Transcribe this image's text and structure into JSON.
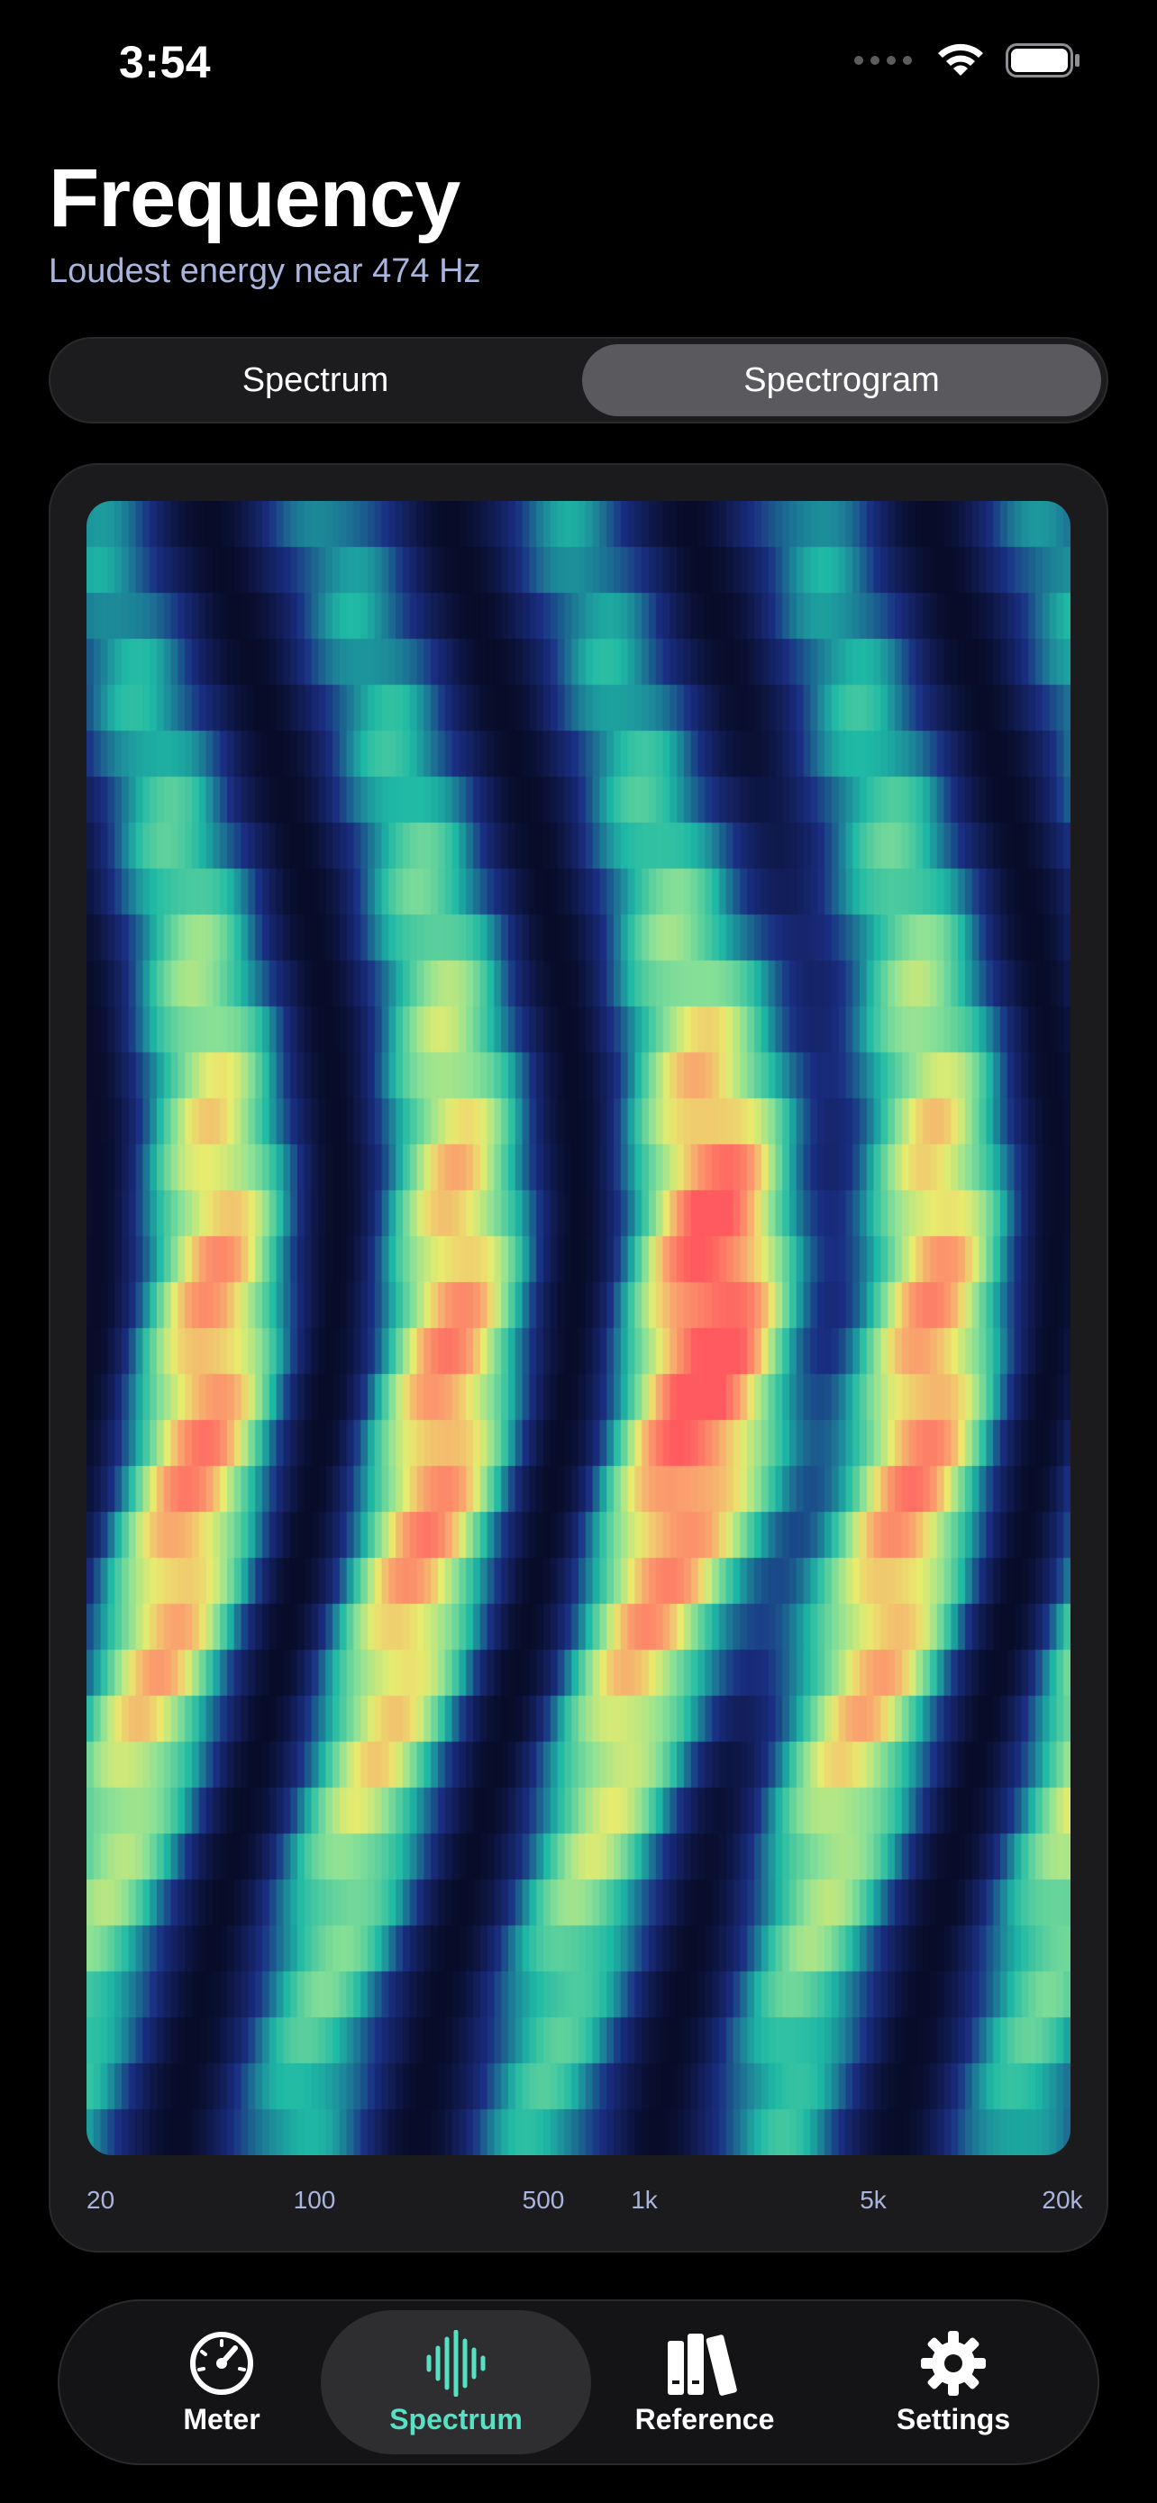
{
  "status_bar": {
    "time": "3:54"
  },
  "header": {
    "title": "Frequency",
    "subtitle": "Loudest energy near 474 Hz"
  },
  "segmented": {
    "options": [
      "Spectrum",
      "Spectrogram"
    ],
    "selected": "Spectrogram"
  },
  "spectrogram": {
    "x_ticks": [
      "20",
      "100",
      "500",
      "1k",
      "5k",
      "20k"
    ],
    "x_scale": "log",
    "x_range_hz": [
      20,
      20000
    ]
  },
  "tabbar": {
    "items": [
      {
        "label": "Meter",
        "icon": "gauge-icon"
      },
      {
        "label": "Spectrum",
        "icon": "waveform-icon"
      },
      {
        "label": "Reference",
        "icon": "books-icon"
      },
      {
        "label": "Settings",
        "icon": "gear-icon"
      }
    ],
    "selected": "Spectrum"
  },
  "colors": {
    "accent": "#56e0c4",
    "subtitle": "#a9b5de",
    "card": "#1b1b1d"
  }
}
